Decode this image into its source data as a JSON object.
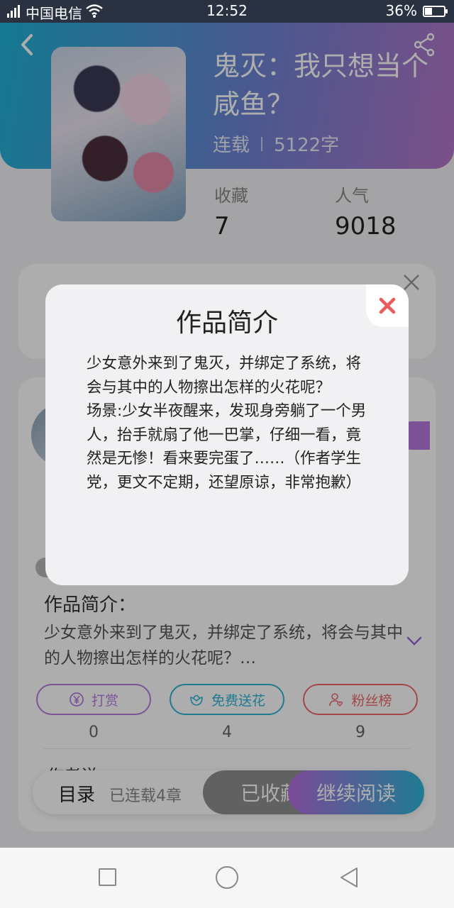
{
  "status_bar": {
    "network": "4G",
    "carrier": "中国电信",
    "time": "12:52",
    "battery_percent": "36%"
  },
  "book": {
    "title": "鬼灭：我只想当个咸鱼？",
    "status": "连载",
    "word_count": "5122字",
    "favorites_label": "收藏",
    "favorites_value": "7",
    "popularity_label": "人气",
    "popularity_value": "9018",
    "intro_label": "作品简介：",
    "intro_preview": "少女意外来到了鬼灭，并绑定了系统，将会与其中的人物擦出怎样的火花呢？…"
  },
  "actions": [
    {
      "label": "打赏",
      "count": "0",
      "color": "#b77ee0",
      "icon": "yen-coin-icon"
    },
    {
      "label": "免费送花",
      "count": "4",
      "color": "#2fb6d8",
      "icon": "flower-icon"
    },
    {
      "label": "粉丝榜",
      "count": "9",
      "color": "#ec6a6a",
      "icon": "fan-user-icon"
    }
  ],
  "section_peek": "作者说",
  "bottom_bar": {
    "catalog": "目录",
    "chapters": "已连载4章",
    "favorited": "已收藏",
    "continue": "继续阅读"
  },
  "modal": {
    "title": "作品简介",
    "body": "少女意外来到了鬼灭，并绑定了系统，将会与其中的人物擦出怎样的火花呢？\n场景:少女半夜醒来，发现身旁躺了一个男人，抬手就扇了他一巴掌，仔细一看，竟然是无惨！看来要完蛋了……（作者学生党，更文不定期，还望原谅，非常抱歉）"
  },
  "colors": {
    "close_x": "#ec5a5a",
    "hero_start": "#1fb3d6",
    "hero_end": "#b676c9"
  }
}
